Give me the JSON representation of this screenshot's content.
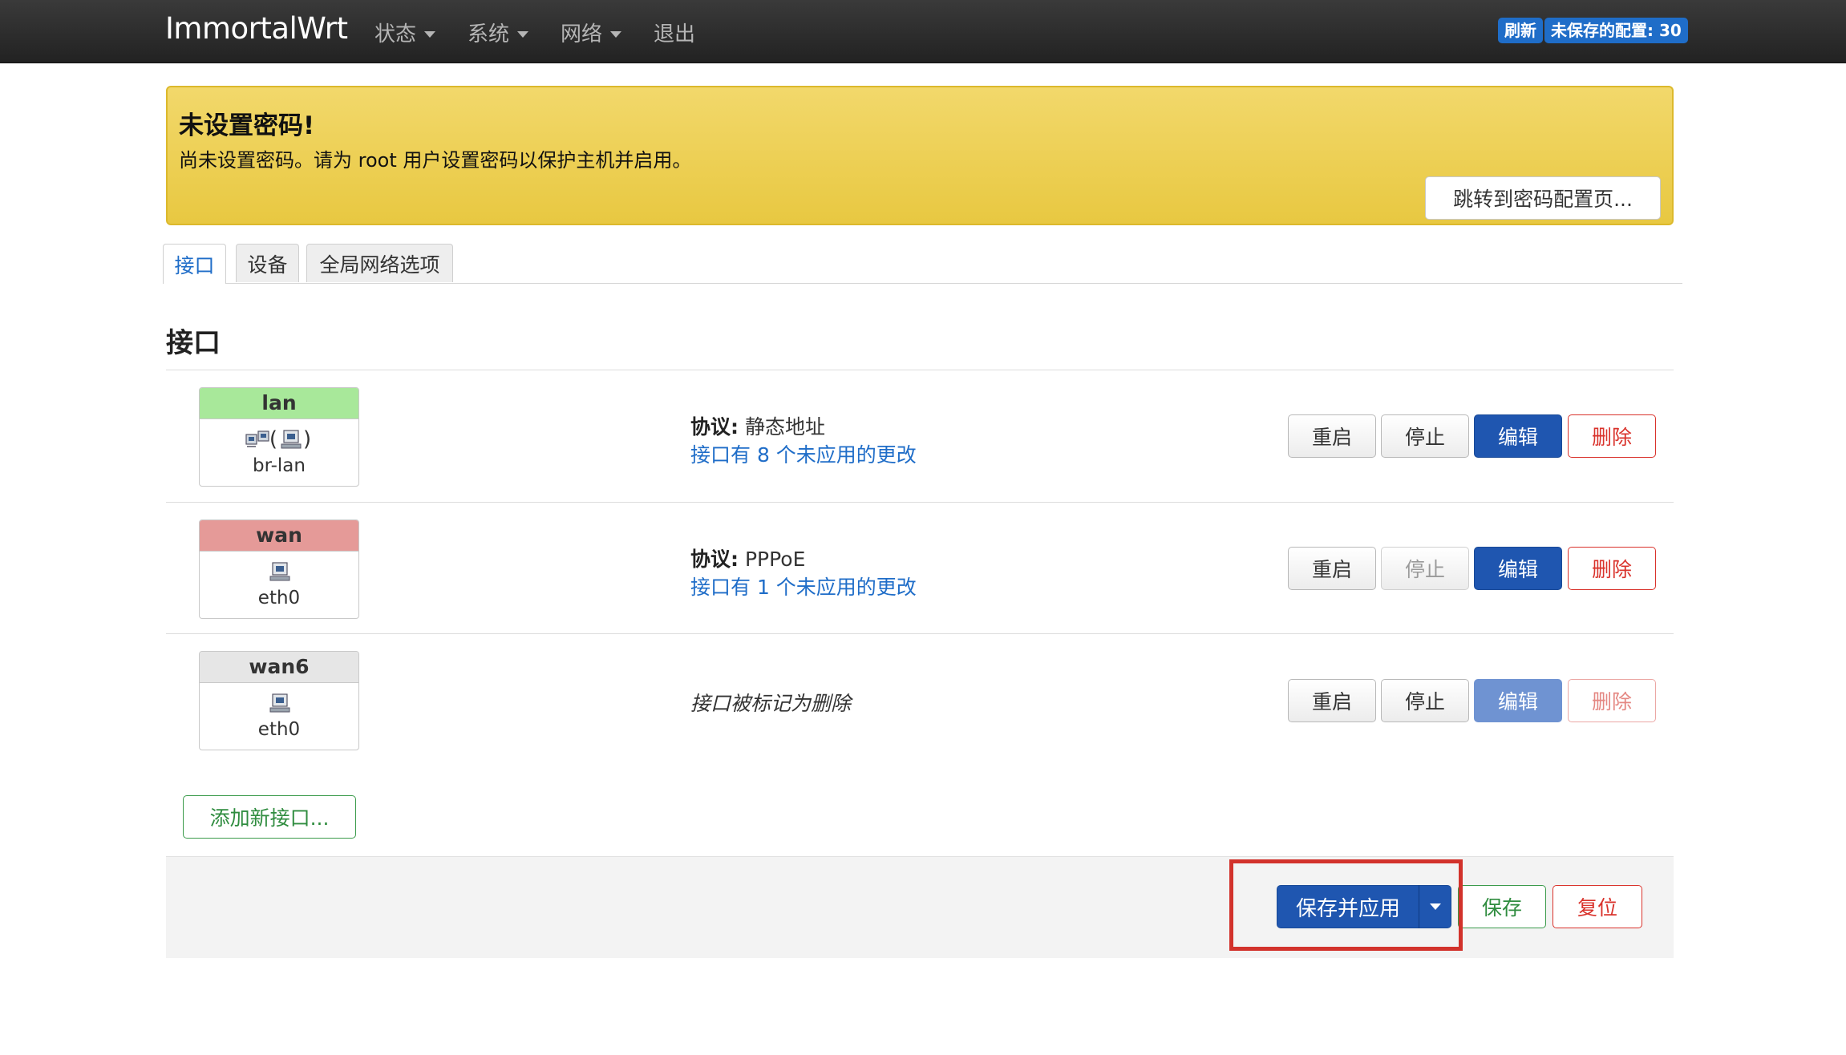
{
  "navbar": {
    "brand": "ImmortalWrt",
    "menu": [
      {
        "label": "状态",
        "has_dropdown": true
      },
      {
        "label": "系统",
        "has_dropdown": true
      },
      {
        "label": "网络",
        "has_dropdown": true
      },
      {
        "label": "退出",
        "has_dropdown": false
      }
    ],
    "refresh_label": "刷新",
    "unsaved_label": "未保存的配置: 30",
    "badge_color": "#1f6dc8"
  },
  "alert": {
    "title": "未设置密码!",
    "text": "尚未设置密码。请为 root 用户设置密码以保护主机并启用。",
    "button": "跳转到密码配置页...",
    "background": "#ecce52"
  },
  "tabs": [
    {
      "label": "接口",
      "active": true
    },
    {
      "label": "设备",
      "active": false
    },
    {
      "label": "全局网络选项",
      "active": false
    }
  ],
  "section_title": "接口",
  "interfaces": [
    {
      "name": "lan",
      "header_color": "#a8e89a",
      "icons": [
        "bridge-icon",
        "ethernet-port-icon"
      ],
      "device": "br-lan",
      "protocol_label": "协议:",
      "protocol": "静态地址",
      "changes": "接口有 8 个未应用的更改",
      "buttons": {
        "restart": "重启",
        "stop": "停止",
        "edit": "编辑",
        "delete": "删除"
      }
    },
    {
      "name": "wan",
      "header_color": "#e59a98",
      "icons": [
        "ethernet-port-icon"
      ],
      "device": "eth0",
      "protocol_label": "协议:",
      "protocol": "PPPoE",
      "changes": "接口有 1 个未应用的更改",
      "buttons": {
        "restart": "重启",
        "stop": "停止",
        "edit": "编辑",
        "delete": "删除"
      },
      "stop_disabled": true
    },
    {
      "name": "wan6",
      "header_color": "#e6e6e6",
      "icons": [
        "ethernet-port-icon"
      ],
      "device": "eth0",
      "marked_deleted": "接口被标记为删除",
      "buttons": {
        "restart": "重启",
        "stop": "停止",
        "edit": "编辑",
        "delete": "删除"
      },
      "edit_disabled": true,
      "delete_disabled": true
    }
  ],
  "add_interface": "添加新接口...",
  "footer": {
    "save_apply": "保存并应用",
    "save": "保存",
    "reset": "复位"
  }
}
